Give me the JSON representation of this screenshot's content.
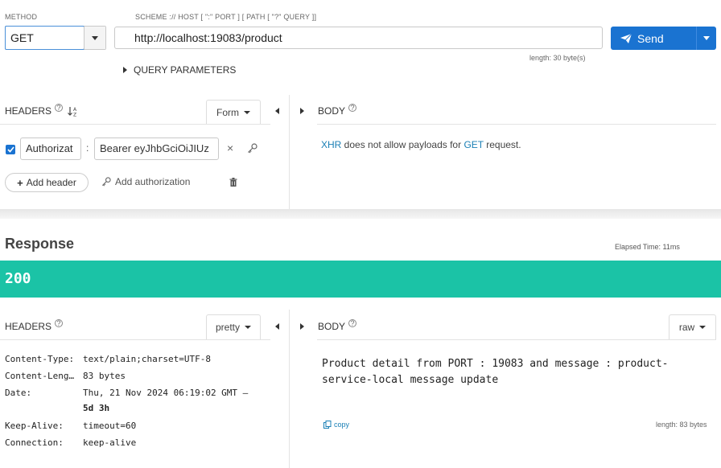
{
  "request": {
    "method_label": "METHOD",
    "method_value": "GET",
    "url_label": "SCHEME :// HOST [ \":\" PORT ] [ PATH [ \"?\" QUERY ]]",
    "url_value": "http://localhost:19083/product",
    "url_length": "length: 30 byte(s)",
    "send_label": "Send",
    "query_params_label": "QUERY PARAMETERS",
    "headers_title": "HEADERS",
    "headers_mode": "Form",
    "body_title": "BODY",
    "header_rows": [
      {
        "checked": true,
        "name": "Authorizat",
        "separator": ":",
        "value": "Bearer eyJhbGciOiJIUz"
      }
    ],
    "add_header_label": "Add header",
    "add_authorization_label": "Add authorization",
    "body_message": {
      "part1": "XHR",
      "part2": " does not allow payloads for ",
      "part3": "GET",
      "part4": " request."
    }
  },
  "response": {
    "title": "Response",
    "elapsed": "Elapsed Time: 11ms",
    "status_code": "200",
    "headers_title": "HEADERS",
    "headers_mode": "pretty",
    "body_title": "BODY",
    "body_mode": "raw",
    "headers": [
      {
        "name": "Content-Type:",
        "value": "text/plain;charset=UTF-8",
        "value2": ""
      },
      {
        "name": "Content-Leng…",
        "value": "83 bytes",
        "value2": ""
      },
      {
        "name": "Date:",
        "value": "Thu, 21 Nov 2024 06:19:02 GMT —",
        "value2": "5d 3h"
      },
      {
        "name": "Keep-Alive:",
        "value": "timeout=60",
        "value2": ""
      },
      {
        "name": "Connection:",
        "value": "keep-alive",
        "value2": ""
      }
    ],
    "body_line1": "Product detail from PORT : 19083 and message : product-",
    "body_line2": "service-local message update",
    "copy_label": "copy",
    "body_length": "length: 83 bytes"
  },
  "colors": {
    "accent": "#1a73d1",
    "status_ok": "#1bc3a6",
    "link": "#1a7fb5"
  }
}
